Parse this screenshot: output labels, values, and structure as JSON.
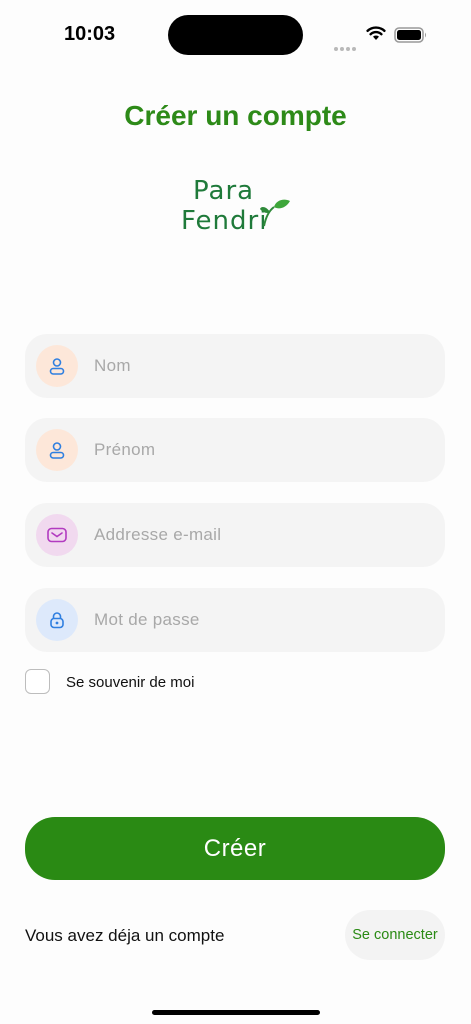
{
  "status_bar": {
    "time": "10:03",
    "icons": [
      "signal-dots-icon",
      "wifi-icon",
      "battery-icon"
    ]
  },
  "header": {
    "title": "Créer un compte"
  },
  "logo": {
    "line1": "Para",
    "line2": "Fendri",
    "color": "#1f7a3a",
    "leaf_color": "#3ea63a"
  },
  "form": {
    "fields": [
      {
        "placeholder": "Nom",
        "value": "",
        "icon": "user-icon",
        "icon_bg": "#fde7d9",
        "icon_color": "#2f7fe0"
      },
      {
        "placeholder": "Prénom",
        "value": "",
        "icon": "user-icon",
        "icon_bg": "#fde7d9",
        "icon_color": "#2f7fe0"
      },
      {
        "placeholder": "Addresse e-mail",
        "value": "",
        "icon": "mail-icon",
        "icon_bg": "#f1d9ef",
        "icon_color": "#b23bc0"
      },
      {
        "placeholder": "Mot de passe",
        "value": "",
        "icon": "lock-icon",
        "icon_bg": "#dde9fb",
        "icon_color": "#2f7fe0"
      }
    ],
    "remember_label": "Se souvenir de moi",
    "remember_checked": false
  },
  "actions": {
    "create_label": "Créer",
    "have_account_text": "Vous avez déja un compte",
    "login_label": "Se connecter"
  },
  "colors": {
    "accent": "#2a8a14",
    "title": "#2d8a18",
    "field_bg": "#f4f4f4"
  }
}
